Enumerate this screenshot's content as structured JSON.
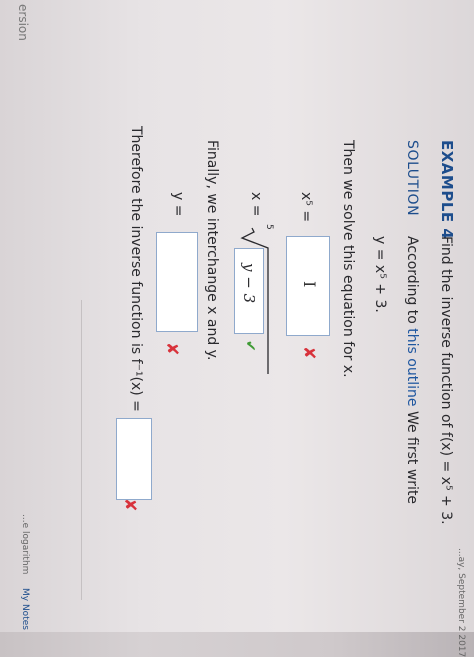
{
  "header": {
    "date": "...ay, September 2 2017"
  },
  "example": {
    "label": "EXAMPLE 4",
    "problem": "Find the inverse function of  f(x) = x⁵ + 3."
  },
  "solution": {
    "label": "SOLUTION",
    "intro_pre": "According to ",
    "intro_link": "this outline",
    "intro_post": " We first write",
    "eq1": "y = x⁵ + 3.",
    "step2": "Then we solve this equation for x.",
    "x5_label": "x⁵ =",
    "x5_value": "",
    "cursor_glyph": "I",
    "x_label": "x =",
    "radical_index": "5",
    "x_value": "y − 3",
    "step3": "Finally, we interchange x and y.",
    "y_label": "y =",
    "y_value": "",
    "conclusion": "Therefore the inverse function is  f⁻¹(x) =",
    "conclusion_value": ""
  },
  "marks": {
    "incorrect": "✘",
    "correct": "✔"
  },
  "footer": {
    "version": "ersion",
    "logarithm": "...e logarithm",
    "my_notes": "My Notes"
  },
  "colors": {
    "accent": "#1d4d8c",
    "incorrect": "#d8323b",
    "correct": "#3f9a35"
  }
}
